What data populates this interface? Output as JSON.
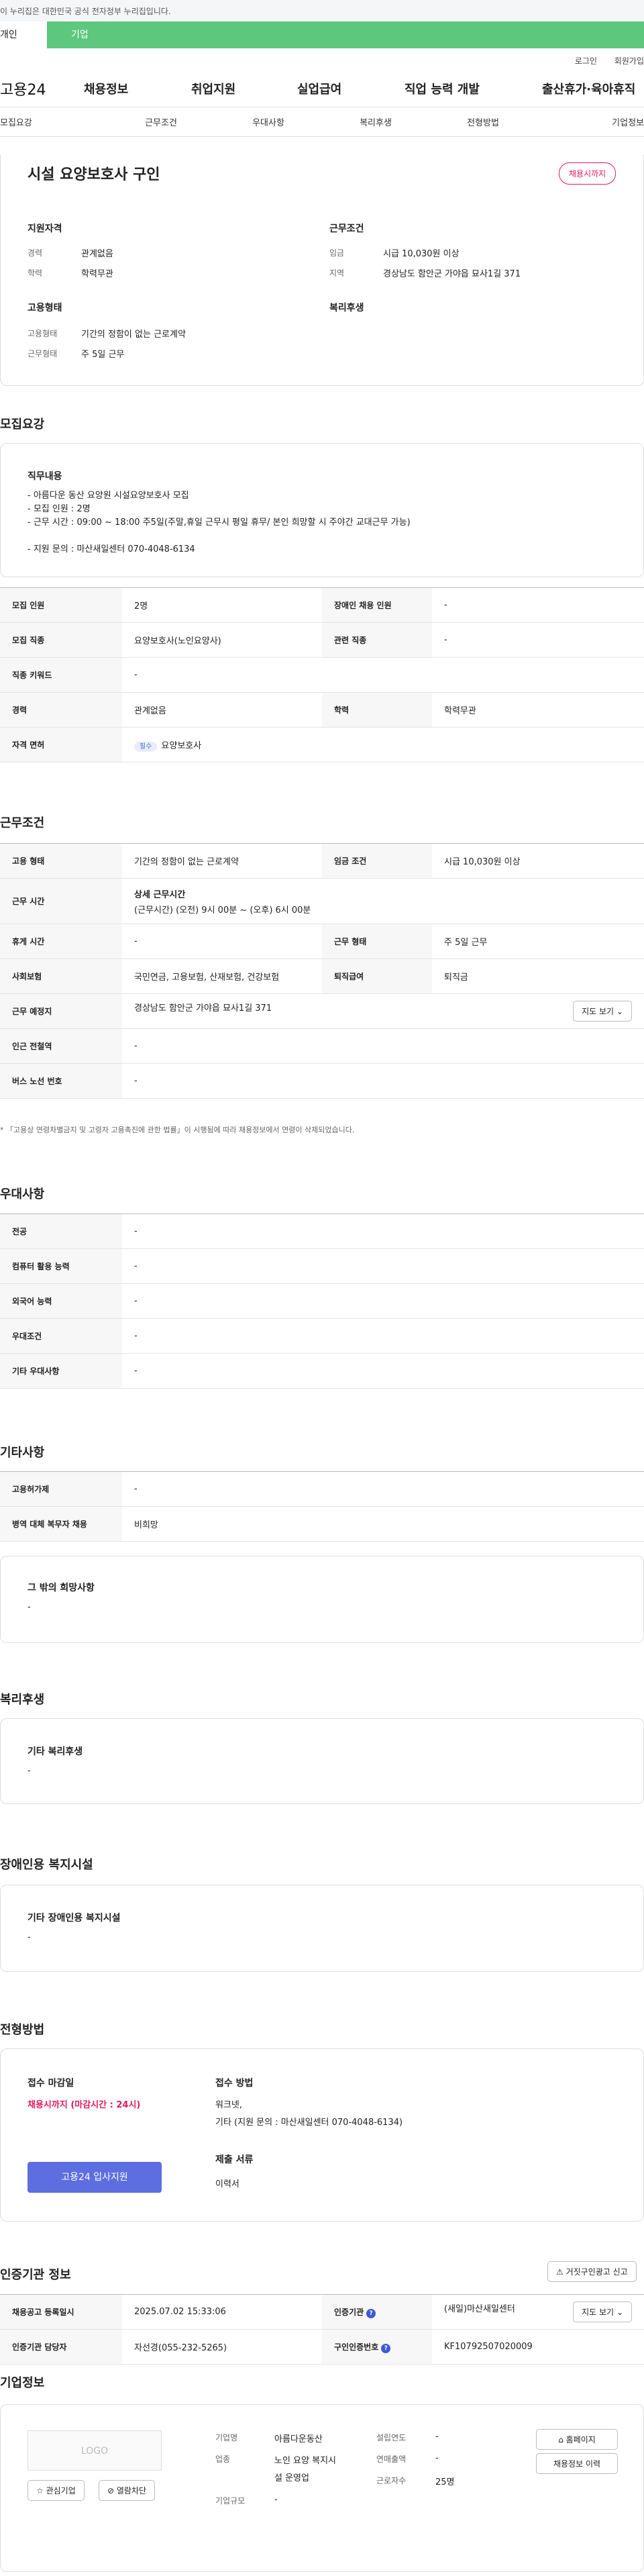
{
  "banner": {
    "text": "이 누리집은 대한민국 공식 전자정부 누리집입니다."
  },
  "tabs": {
    "person": "개인",
    "biz": "기업"
  },
  "util": {
    "login": "로그인",
    "join": "회원가입"
  },
  "gnb": {
    "logo": "고용24",
    "menu": [
      "채용정보",
      "취업지원",
      "실업급여",
      "직업 능력 개발",
      "출산휴가·육아휴직"
    ]
  },
  "subnav": [
    "모집요강",
    "근무조건",
    "우대사항",
    "복리후생",
    "전형방법",
    "기업정보"
  ],
  "summary": {
    "title": "시설 요양보호사 구인",
    "badge": "채용시까지",
    "qual_title": "지원자격",
    "career_label": "경력",
    "career": "관계없음",
    "edu_label": "학력",
    "edu": "학력무관",
    "work_title": "근무조건",
    "wage_label": "임금",
    "wage": "시급 10,030원 이상",
    "region_label": "지역",
    "region": "경상남도 함안군 가야읍 묘사1길 371",
    "emp_title": "고용형태",
    "emptype_label": "고용형태",
    "emptype": "기간의 정함이 없는 근로계약",
    "worktype_label": "근무형태",
    "worktype": "주 5일 근무",
    "welfare_title": "복리후생"
  },
  "recruit": {
    "section": "모집요강",
    "duty_title": "직무내용",
    "duty_lines": [
      "- 아름다운 동산 요양원 시설요양보호사 모집",
      "- 모집 인원 : 2명",
      "- 근무 시간 : 09:00 ~ 18:00 주5일(주말,휴일 근무시 평일 휴무/ 본인 희망할 시 주야간 교대근무 가능)",
      "",
      "- 지원 문의 : 마산새일센터 070-4048-6134"
    ],
    "rows": [
      {
        "l1": "모집 인원",
        "v1": "2명",
        "l2": "장애인 채용 인원",
        "v2": "-"
      },
      {
        "l1": "모집 직종",
        "v1": "요양보호사(노인요양사)",
        "l2": "관련 직종",
        "v2": "-"
      },
      {
        "l1": "직종 키워드",
        "v1": "-"
      },
      {
        "l1": "경력",
        "v1": "관계없음",
        "l2": "학력",
        "v2": "학력무관"
      },
      {
        "l1": "자격 면허",
        "pill": "필수",
        "v1": "요양보호사"
      }
    ]
  },
  "cond": {
    "section": "근무조건",
    "r1": {
      "l1": "고용 형태",
      "v1": "기간의 정함이 없는 근로계약",
      "l2": "임금 조건",
      "v2": "시급 10,030원 이상"
    },
    "r2": {
      "l1": "근무 시간",
      "v1a": "상세 근무시간",
      "v1b": "(근무시간) (오전) 9시 00분 ~ (오후) 6시 00분"
    },
    "r3": {
      "l1": "휴게 시간",
      "v1": "-",
      "l2": "근무 형태",
      "v2": "주 5일 근무"
    },
    "r4": {
      "l1": "사회보험",
      "v1": "국민연금, 고용보험, 산재보험, 건강보험",
      "l2": "퇴직급여",
      "v2": "퇴직금"
    },
    "r5": {
      "l1": "근무 예정지",
      "v1": "경상남도 함안군 가야읍 묘사1길 371",
      "btn": "지도 보기"
    },
    "r6": {
      "l1": "인근 전철역",
      "v1": "-"
    },
    "r7": {
      "l1": "버스 노선 번호",
      "v1": "-"
    },
    "note": "「고용상 연령차별금지 및 고령자 고용촉진에 관한 법률」이 시행됨에 따라 채용정보에서 연령이 삭제되었습니다."
  },
  "pref": {
    "section": "우대사항",
    "rows": [
      {
        "l": "전공",
        "v": "-"
      },
      {
        "l": "컴퓨터 활용 능력",
        "v": "-"
      },
      {
        "l": "외국어 능력",
        "v": "-"
      },
      {
        "l": "우대조건",
        "v": "-"
      },
      {
        "l": "기타 우대사항",
        "v": "-"
      }
    ]
  },
  "etc": {
    "section": "기타사항",
    "rows": [
      {
        "l": "고용허가제",
        "v": "-"
      },
      {
        "l": "병역 대체 복무자 채용",
        "v": "비희망"
      }
    ],
    "wish_title": "그 밖의 희망사항",
    "wish": "-"
  },
  "welfare": {
    "section": "복리후생",
    "title": "기타 복리후생",
    "value": "-"
  },
  "facility": {
    "section": "장애인용 복지시설",
    "title": "기타 장애인용 복지시설",
    "value": "-"
  },
  "process": {
    "section": "전형방법",
    "deadline_title": "접수 마감일",
    "deadline": "채용시까지 (마감시간 : 24시)",
    "apply_btn": "고용24 입사지원",
    "method_title": "접수 방법",
    "method1": "워크넷,",
    "method2": "기타 (지원 문의 : 마산새일센터 070-4048-6134)",
    "docs_title": "제출 서류",
    "docs": "이력서"
  },
  "cert": {
    "section": "인증기관 정보",
    "report_btn": "거짓구인광고 신고",
    "r1": {
      "l1": "채용공고 등록일시",
      "v1": "2025.07.02 15:33:06",
      "l2": "인증기관",
      "v2": "(새일)마산새일센터",
      "btn": "지도 보기"
    },
    "r2": {
      "l1": "인증기관 담당자",
      "v1": "자선경(055-232-5265)",
      "l2": "구인인증번호",
      "v2": "KF10792507020009"
    }
  },
  "company": {
    "section": "기업정보",
    "logo": "LOGO",
    "fav_btn": "관심기업",
    "block_btn": "열람차단",
    "name_label": "기업명",
    "name": "아름다운동산",
    "industry_label": "업종",
    "industry1": "노인 요양 복지시",
    "industry2": "설 운영업",
    "scale_label": "기업규모",
    "scale": "-",
    "est_label": "설립연도",
    "est": "-",
    "sales_label": "연매출액",
    "sales": "-",
    "emp_label": "근로자수",
    "emp": "25명",
    "home_btn": "홈페이지",
    "history_btn": "채용정보 이력"
  }
}
